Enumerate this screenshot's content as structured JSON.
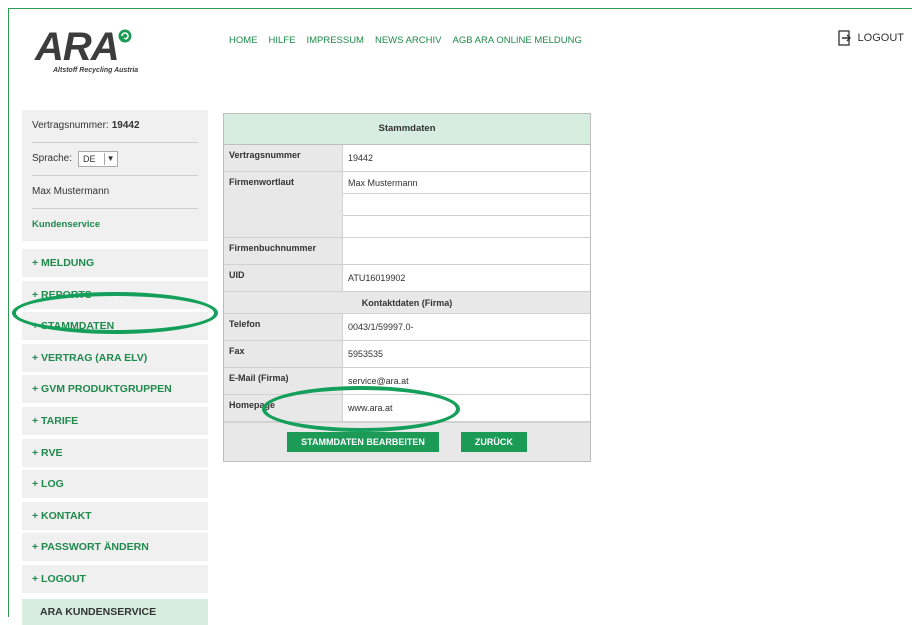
{
  "logo": {
    "text": "ARA",
    "subtitle": "Altstoff Recycling Austria"
  },
  "topnav": [
    "HOME",
    "HILFE",
    "IMPRESSUM",
    "NEWS ARCHIV",
    "AGB ARA ONLINE MELDUNG"
  ],
  "header": {
    "logout_label": "LOGOUT"
  },
  "sidebar": {
    "contract_label": "Vertragsnummer:",
    "contract_number": "19442",
    "language_label": "Sprache:",
    "language_value": "DE",
    "user_name": "Max Mustermann",
    "customer_service_link": "Kundenservice",
    "menu": [
      "+ MELDUNG",
      "+ REPORTS",
      "+ STAMMDATEN",
      "+ VERTRAG (ARA ELV)",
      "+ GVM PRODUKTGRUPPEN",
      "+ TARIFE",
      "+ RVE",
      "+ LOG",
      "+ KONTAKT",
      "+ PASSWORT ÄNDERN",
      "+ LOGOUT"
    ],
    "service_box": "ARA KUNDENSERVICE"
  },
  "panel": {
    "title": "Stammdaten",
    "rows": {
      "vertragsnummer": {
        "label": "Vertragsnummer",
        "value": "19442"
      },
      "firmenwortlaut": {
        "label": "Firmenwortlaut",
        "value1": "Max Mustermann",
        "value2": "",
        "value3": ""
      },
      "firmenbuchnummer": {
        "label": "Firmenbuchnummer",
        "value": ""
      },
      "uid": {
        "label": "UID",
        "value": "ATU16019902"
      }
    },
    "contact_heading": "Kontaktdaten (Firma)",
    "contact": {
      "telefon": {
        "label": "Telefon",
        "value": "0043/1/59997.0-"
      },
      "fax": {
        "label": "Fax",
        "value": "5953535"
      },
      "email": {
        "label": "E-Mail (Firma)",
        "value": "service@ara.at"
      },
      "homepage": {
        "label": "Homepage",
        "value": "www.ara.at"
      }
    },
    "edit_button": "STAMMDATEN BEARBEITEN",
    "back_button": "ZURÜCK"
  },
  "colors": {
    "brand_green": "#1c9b57",
    "light_green": "#d6ede0",
    "panel_gray": "#e8e8e8",
    "highlight_ellipse": "#14a05a"
  }
}
